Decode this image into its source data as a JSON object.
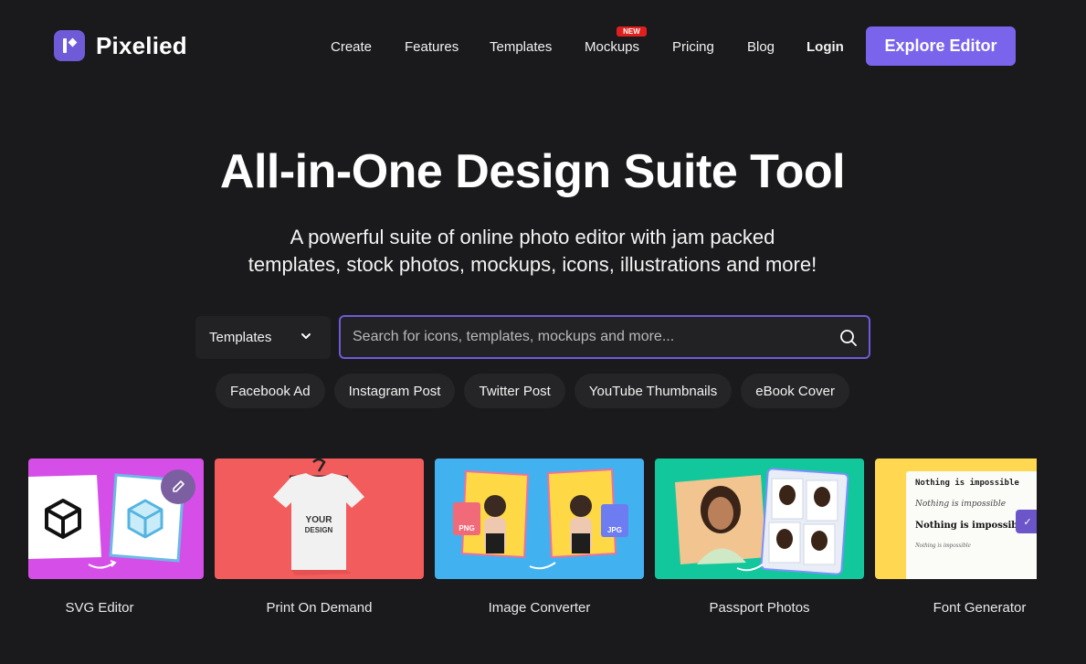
{
  "brand": {
    "name": "Pixelied",
    "logo_icon": "pixelied-logo-icon"
  },
  "nav": {
    "items": [
      "Create",
      "Features",
      "Templates",
      "Mockups",
      "Pricing",
      "Blog"
    ],
    "new_badge": "NEW",
    "login": "Login",
    "cta": "Explore Editor"
  },
  "hero": {
    "title": "All-in-One Design Suite Tool",
    "subtitle_line1": "A powerful suite of online photo editor with jam packed",
    "subtitle_line2": "templates, stock photos, mockups, icons, illustrations and more!"
  },
  "search": {
    "type_value": "Templates",
    "placeholder": "Search for icons, templates, mockups and more..."
  },
  "chips": [
    "Facebook Ad",
    "Instagram Post",
    "Twitter Post",
    "YouTube Thumbnails",
    "eBook Cover"
  ],
  "tools": [
    {
      "label": "SVG Editor"
    },
    {
      "label": "Print On Demand",
      "shirt_text_1": "YOUR",
      "shirt_text_2": "DESIGN"
    },
    {
      "label": "Image Converter",
      "badge_png": "PNG",
      "badge_jpg": "JPG"
    },
    {
      "label": "Passport Photos"
    },
    {
      "label": "Font Generator",
      "samples": [
        "Nothing is impossible",
        "Nothing is impossible",
        "Nothing is impossible",
        "Nothing is impossible"
      ]
    }
  ],
  "colors": {
    "background": "#1a191b",
    "accent": "#7b64ec",
    "new_badge": "#e0201f"
  }
}
